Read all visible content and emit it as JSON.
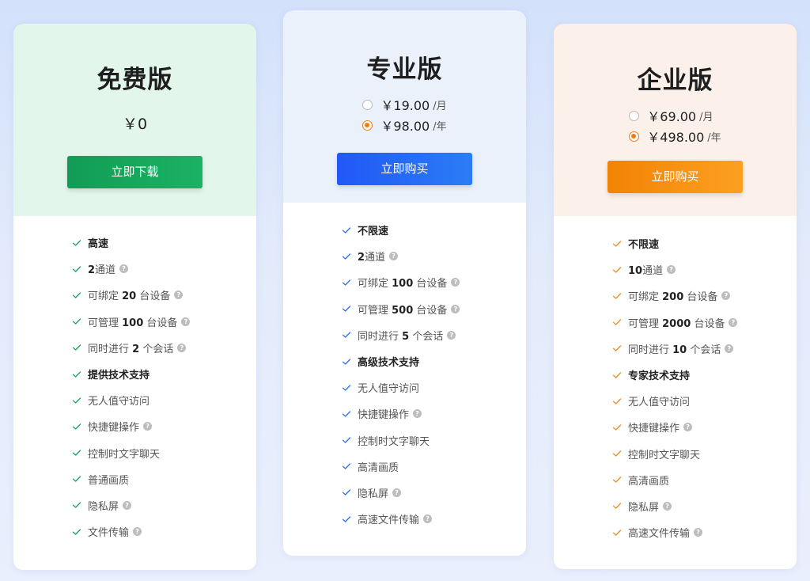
{
  "plans": [
    {
      "title": "免费版",
      "price": "￥0",
      "button_label": "立即下载",
      "features": [
        {
          "text": "高速",
          "bold": true,
          "help": false
        },
        {
          "pre": "",
          "num": "2",
          "post": "通道",
          "help": true
        },
        {
          "pre": "可绑定 ",
          "num": "20",
          "post": " 台设备",
          "help": true
        },
        {
          "pre": "可管理 ",
          "num": "100",
          "post": " 台设备",
          "help": true
        },
        {
          "pre": "同时进行 ",
          "num": "2",
          "post": " 个会话",
          "help": true
        },
        {
          "text": "提供技术支持",
          "bold": true,
          "help": false
        },
        {
          "text": "无人值守访问",
          "bold": false,
          "help": false
        },
        {
          "text": "快捷键操作",
          "bold": false,
          "help": true
        },
        {
          "text": "控制时文字聊天",
          "bold": false,
          "help": false
        },
        {
          "text": "普通画质",
          "bold": false,
          "help": false
        },
        {
          "text": "隐私屏",
          "bold": false,
          "help": true
        },
        {
          "text": "文件传输",
          "bold": false,
          "help": true
        }
      ]
    },
    {
      "title": "专业版",
      "prices": [
        {
          "amount": "￥19.00",
          "unit": "/月",
          "selected": false
        },
        {
          "amount": "￥98.00",
          "unit": "/年",
          "selected": true
        }
      ],
      "button_label": "立即购买",
      "features": [
        {
          "text": "不限速",
          "bold": true,
          "help": false
        },
        {
          "pre": "",
          "num": "2",
          "post": "通道",
          "help": true
        },
        {
          "pre": "可绑定 ",
          "num": "100",
          "post": " 台设备",
          "help": true
        },
        {
          "pre": "可管理 ",
          "num": "500",
          "post": " 台设备",
          "help": true
        },
        {
          "pre": "同时进行 ",
          "num": "5",
          "post": " 个会话",
          "help": true
        },
        {
          "text": "高级技术支持",
          "bold": true,
          "help": false
        },
        {
          "text": "无人值守访问",
          "bold": false,
          "help": false
        },
        {
          "text": "快捷键操作",
          "bold": false,
          "help": true
        },
        {
          "text": "控制时文字聊天",
          "bold": false,
          "help": false
        },
        {
          "text": "高清画质",
          "bold": false,
          "help": false
        },
        {
          "text": "隐私屏",
          "bold": false,
          "help": true
        },
        {
          "text": "高速文件传输",
          "bold": false,
          "help": true
        }
      ]
    },
    {
      "title": "企业版",
      "prices": [
        {
          "amount": "￥69.00",
          "unit": "/月",
          "selected": false
        },
        {
          "amount": "￥498.00",
          "unit": "/年",
          "selected": true
        }
      ],
      "button_label": "立即购买",
      "features": [
        {
          "text": "不限速",
          "bold": true,
          "help": false
        },
        {
          "pre": "",
          "num": "10",
          "post": "通道",
          "help": true
        },
        {
          "pre": "可绑定 ",
          "num": "200",
          "post": " 台设备",
          "help": true
        },
        {
          "pre": "可管理 ",
          "num": "2000",
          "post": " 台设备",
          "help": true
        },
        {
          "pre": "同时进行 ",
          "num": "10",
          "post": " 个会话",
          "help": true
        },
        {
          "text": "专家技术支持",
          "bold": true,
          "help": false
        },
        {
          "text": "无人值守访问",
          "bold": false,
          "help": false
        },
        {
          "text": "快捷键操作",
          "bold": false,
          "help": true
        },
        {
          "text": "控制时文字聊天",
          "bold": false,
          "help": false
        },
        {
          "text": "高清画质",
          "bold": false,
          "help": false
        },
        {
          "text": "隐私屏",
          "bold": false,
          "help": true
        },
        {
          "text": "高速文件传输",
          "bold": false,
          "help": true
        }
      ]
    }
  ],
  "help_glyph": "?",
  "icons": {
    "check": "check-icon",
    "help": "help-icon",
    "radio": "radio-button"
  },
  "colors": {
    "free_accent": "#17a257",
    "pro_accent": "#2c68f5",
    "enterprise_accent": "#f9860f",
    "radio_selected": "#f07d14"
  }
}
